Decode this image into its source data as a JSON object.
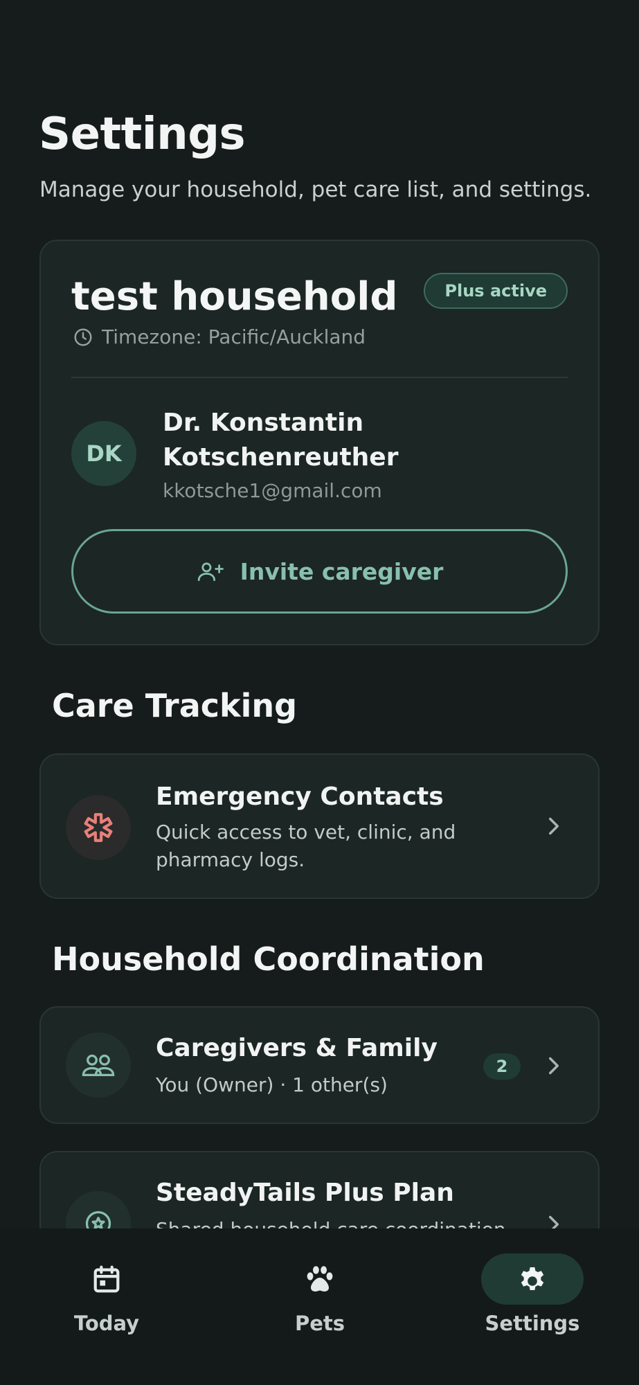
{
  "header": {
    "title": "Settings",
    "subtitle": "Manage your household, pet care list, and settings."
  },
  "household": {
    "name": "test household",
    "plan_badge": "Plus active",
    "timezone_icon": "clock-icon",
    "timezone": "Timezone: Pacific/Auckland",
    "user": {
      "initials": "DK",
      "name": "Dr. Konstantin Kotschenreuther",
      "email": "kkotsche1@gmail.com"
    },
    "invite_icon": "user-plus-icon",
    "invite_label": "Invite caregiver"
  },
  "sections": {
    "care_tracking": {
      "heading": "Care Tracking",
      "items": [
        {
          "icon": "medical-asterisk-icon",
          "title": "Emergency Contacts",
          "description": "Quick access to vet, clinic, and pharmacy logs."
        }
      ]
    },
    "household_coordination": {
      "heading": "Household Coordination",
      "items": [
        {
          "icon": "people-icon",
          "title": "Caregivers & Family",
          "description": "You (Owner) · 1 other(s)",
          "badge": "2"
        },
        {
          "icon": "star-badge-icon",
          "title": "SteadyTails Plus Plan",
          "description": "Shared household care coordination"
        }
      ]
    }
  },
  "nav": {
    "items": [
      {
        "label": "Today",
        "icon": "calendar-icon",
        "active": false
      },
      {
        "label": "Pets",
        "icon": "paw-icon",
        "active": false
      },
      {
        "label": "Settings",
        "icon": "gear-icon",
        "active": true
      }
    ]
  },
  "colors": {
    "background": "#141a19",
    "card": "#1c2624",
    "accent": "#88c0ad",
    "emergency": "#e8807a"
  }
}
